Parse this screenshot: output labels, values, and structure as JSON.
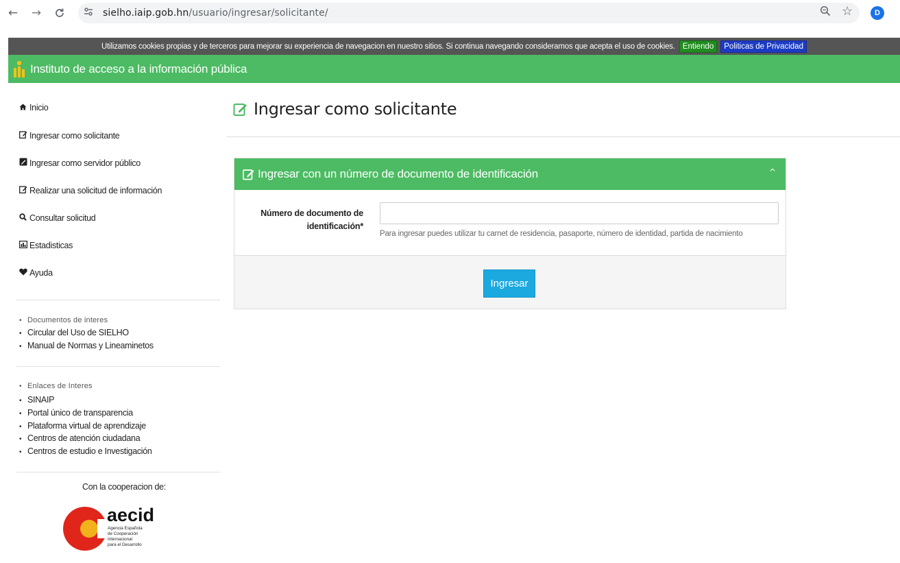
{
  "browser": {
    "url_host": "sielho.iaip.gob.hn",
    "url_path": "/usuario/ingresar/solicitante/",
    "profile_initial": "D"
  },
  "cookie_bar": {
    "message": "Utilizamos cookies propias y de terceros para mejorar su experiencia de navegacion en nuestro sitios. Si continua navegando consideramos que acepta el uso de cookies.",
    "accept_label": "Entiendo",
    "privacy_label": "Politicas de Privacidad"
  },
  "header": {
    "title": "Instituto de acceso a la información pública"
  },
  "sidebar": {
    "menu": [
      {
        "label": "Inicio",
        "icon": "home-icon"
      },
      {
        "label": "Ingresar como solicitante",
        "icon": "edit-icon"
      },
      {
        "label": "Ingresar como servidor público",
        "icon": "edit-filled-icon"
      },
      {
        "label": "Realizar una solicitud de información",
        "icon": "edit-icon"
      },
      {
        "label": "Consultar solicitud",
        "icon": "search-icon"
      },
      {
        "label": "Estadisticas",
        "icon": "chart-icon"
      },
      {
        "label": "Ayuda",
        "icon": "heart-icon"
      }
    ],
    "documents_title": "Documentos de interes",
    "documents": [
      "Circular del Uso de SIELHO",
      "Manual de Normas y Lineaminetos"
    ],
    "links_title": "Enlaces de Interes",
    "links": [
      "SINAIP",
      "Portal único de transparencia",
      "Plataforma virtual de aprendizaje",
      "Centros de atención ciudadana",
      "Centros de estudio e Investigación"
    ],
    "cooperation_label": "Con la cooperacion de:",
    "aecid": {
      "name": "aecid",
      "line1": "Agencia Española",
      "line2": "de Cooperación",
      "line3": "Internacional",
      "line4": "para el Desarrollo"
    }
  },
  "main": {
    "page_title": "Ingresar como solicitante",
    "panel_title": "Ingresar con un número de documento de identificación",
    "field_label_line1": "Número de documento de",
    "field_label_line2": "identificación*",
    "field_value": "",
    "field_help": "Para ingresar puedes utilizar tu carnet de residencia, pasaporte, número de identidad, partida de nacimiento",
    "submit_label": "Ingresar"
  },
  "colors": {
    "brand_green": "#4cbb63",
    "cookie_bar": "#555555",
    "accept_green": "#1f8d1f",
    "privacy_blue": "#1c3cc4",
    "button_blue": "#1ba9e0"
  }
}
